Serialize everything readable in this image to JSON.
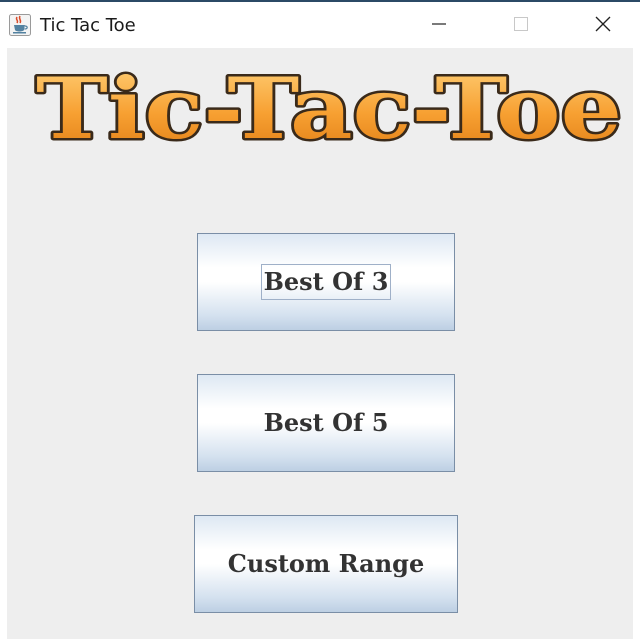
{
  "window": {
    "title": "Tic Tac Toe",
    "icon": "java-cup-icon",
    "controls": {
      "minimize_icon": "minimize-icon",
      "maximize_icon": "maximize-icon",
      "close_icon": "close-icon"
    }
  },
  "logo": {
    "text": "Tic-Tac-Toe",
    "fill_color": "#f7a032",
    "outline_color": "#3a2a1a"
  },
  "menu": {
    "buttons": [
      {
        "label": "Best Of 3"
      },
      {
        "label": "Best Of 5"
      },
      {
        "label": "Custom Range"
      }
    ]
  },
  "colors": {
    "background": "#eeeeee",
    "button_border": "#7a8ea6",
    "button_text": "#333333"
  }
}
